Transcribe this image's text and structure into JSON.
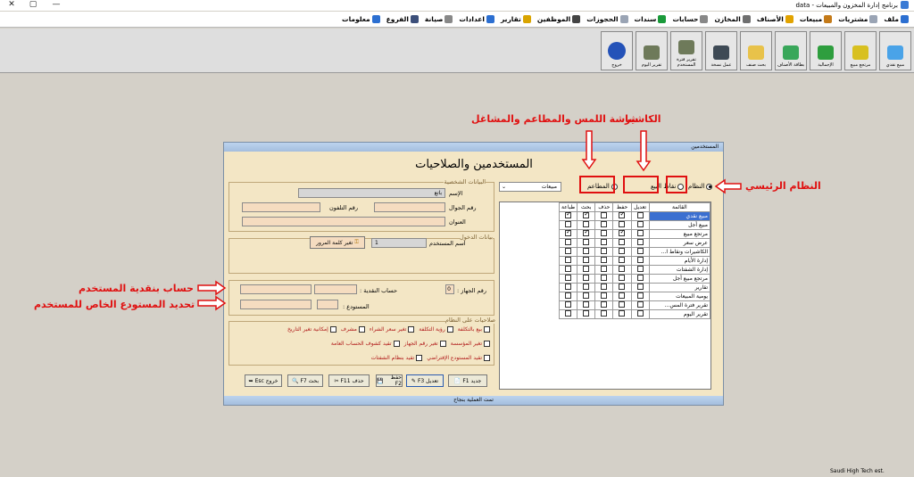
{
  "titlebar": {
    "title": "برنامج إدارة المخزون والمبيعات - data",
    "min": "—",
    "max": "▢",
    "close": "✕"
  },
  "menu": [
    {
      "label": "ملف",
      "icon": "file-icon",
      "color": "#2c6fd1"
    },
    {
      "label": "مشتريات",
      "icon": "purchases-icon",
      "color": "#9aa4b4"
    },
    {
      "label": "مبيعات",
      "icon": "sales-icon",
      "color": "#c47a18"
    },
    {
      "label": "الأصناف",
      "icon": "items-icon",
      "color": "#e2a300"
    },
    {
      "label": "المخازن",
      "icon": "warehouse-icon",
      "color": "#6f6f6f"
    },
    {
      "label": "حسابات",
      "icon": "accounts-icon",
      "color": "#888"
    },
    {
      "label": "سندات",
      "icon": "vouchers-icon",
      "color": "#1a9a3a"
    },
    {
      "label": "الحجوزات",
      "icon": "reservations-icon",
      "color": "#9aa4b4"
    },
    {
      "label": "الموظفين",
      "icon": "employees-icon",
      "color": "#444"
    },
    {
      "label": "تقارير",
      "icon": "reports-icon",
      "color": "#d9a400"
    },
    {
      "label": "اعدادات",
      "icon": "settings-icon",
      "color": "#2c6fd1"
    },
    {
      "label": "صيانة",
      "icon": "maintenance-icon",
      "color": "#888"
    },
    {
      "label": "الفروع",
      "icon": "branches-icon",
      "color": "#3c4f7a"
    },
    {
      "label": "معلومات",
      "icon": "info-icon",
      "color": "#2c6fd1"
    }
  ],
  "toolbar": [
    {
      "label": "مبيع نقدي",
      "icon": "cash-sale-icon",
      "color": "#4aa3e8"
    },
    {
      "label": "مرتجع مبيع",
      "icon": "sales-return-icon",
      "color": "#d8c020"
    },
    {
      "label": "الإجمالية",
      "icon": "totals-icon",
      "color": "#2e9e3e"
    },
    {
      "label": "بطاقة الأصناف",
      "icon": "items-card-icon",
      "color": "#39a75a"
    },
    {
      "label": "بحث صنف",
      "icon": "item-search-icon",
      "color": "#e8c24a"
    },
    {
      "label": "عمل نسخة",
      "icon": "backup-icon",
      "color": "#3e4a55"
    },
    {
      "label": "تقرير فترة المستخدم",
      "icon": "user-period-report-icon",
      "color": "#6e7a5a"
    },
    {
      "label": "تقرير اليوم",
      "icon": "daily-report-icon",
      "color": "#6e7a5a"
    },
    {
      "label": "خروج",
      "icon": "exit-lock-icon",
      "color": "#2452b8"
    }
  ],
  "dialog": {
    "header": "المستخدمين",
    "title": "المستخدمين والصلاحيات",
    "personal_legend": "البيانات الشخصية",
    "name_label": "الإسم",
    "name_value": "باتع",
    "mobile_label": "رقم الجوال",
    "phone_label": "رقم التلفون",
    "address_label": "العنوان",
    "login_legend": "بيانات الدخول",
    "username_label": "اسم المستخدم",
    "username_value": "1",
    "change_password": "تغير كلمة المرور",
    "device_label": "رقم الجهاز :",
    "device_value": "0",
    "cashier_label": "حساب النقدية :",
    "warehouse_label": "المستودع :",
    "perms_legend": "صلاحيات على النظام",
    "perms": [
      [
        "بيع بالتكلفة",
        "رؤية التكلفة",
        "تغير سعر الشراء",
        "مشرف",
        "إمكانية تغير التاريخ"
      ],
      [
        "تغير المؤسسة",
        "تغير رقم الجهاز",
        "تقيد كشوف الحساب العامة"
      ],
      [
        "تقيد المستودع الإفتراضي",
        "تقيد بنظام الشفتات"
      ]
    ],
    "mode_system": "النظام",
    "mode_pos": "نقاط البيع",
    "mode_restaurants": "المطاعم",
    "dropdown_value": "مبيعات",
    "grid_headers": [
      "القائمة",
      "تعديل",
      "حفظ",
      "حذف",
      "بحث",
      "طباعة"
    ],
    "grid_rows": [
      {
        "name": "مبيع نقدي",
        "checks": [
          false,
          true,
          false,
          true,
          true
        ],
        "selected": true
      },
      {
        "name": "مبيع أجل",
        "checks": [
          false,
          false,
          false,
          false,
          false
        ]
      },
      {
        "name": "مرتجع مبيع",
        "checks": [
          false,
          true,
          false,
          true,
          true
        ]
      },
      {
        "name": "عرض سعر",
        "checks": [
          false,
          false,
          false,
          false,
          false
        ]
      },
      {
        "name": "الكاشيرات ونقاط ا...",
        "checks": [
          false,
          false,
          false,
          false,
          false
        ]
      },
      {
        "name": "إدارة الأيام",
        "checks": [
          false,
          false,
          false,
          false,
          false
        ]
      },
      {
        "name": "إدارة الشفتات",
        "checks": [
          false,
          false,
          false,
          false,
          false
        ]
      },
      {
        "name": "مرتجع مبيع أجل",
        "checks": [
          false,
          false,
          false,
          false,
          false
        ]
      },
      {
        "name": "تقارير",
        "checks": [
          false,
          false,
          false,
          false,
          false
        ]
      },
      {
        "name": "يومية المبيعات",
        "checks": [
          false,
          false,
          false,
          false,
          false
        ]
      },
      {
        "name": "تقرير فترة المس...",
        "checks": [
          false,
          false,
          false,
          false,
          false
        ]
      },
      {
        "name": "تقرير اليوم",
        "checks": [
          false,
          false,
          false,
          false,
          false
        ]
      }
    ],
    "buttons": [
      "جديد F1",
      "تعديل F3",
      "حفظ F2",
      "حذف F11",
      "بحث F7",
      "خروج Esc"
    ],
    "footer": "تمت العملية بنجاح"
  },
  "annotations": {
    "cashier": "الكاشير",
    "touch": "شاشة اللمس والمطاعم والمشاغل",
    "main_system": "النظام الرئيسي",
    "cash_account": "حساب بنقدية المستخدم",
    "warehouse": "تحديد المستودع الخاص للمستخدم"
  },
  "status": "Saudi High Tech est."
}
